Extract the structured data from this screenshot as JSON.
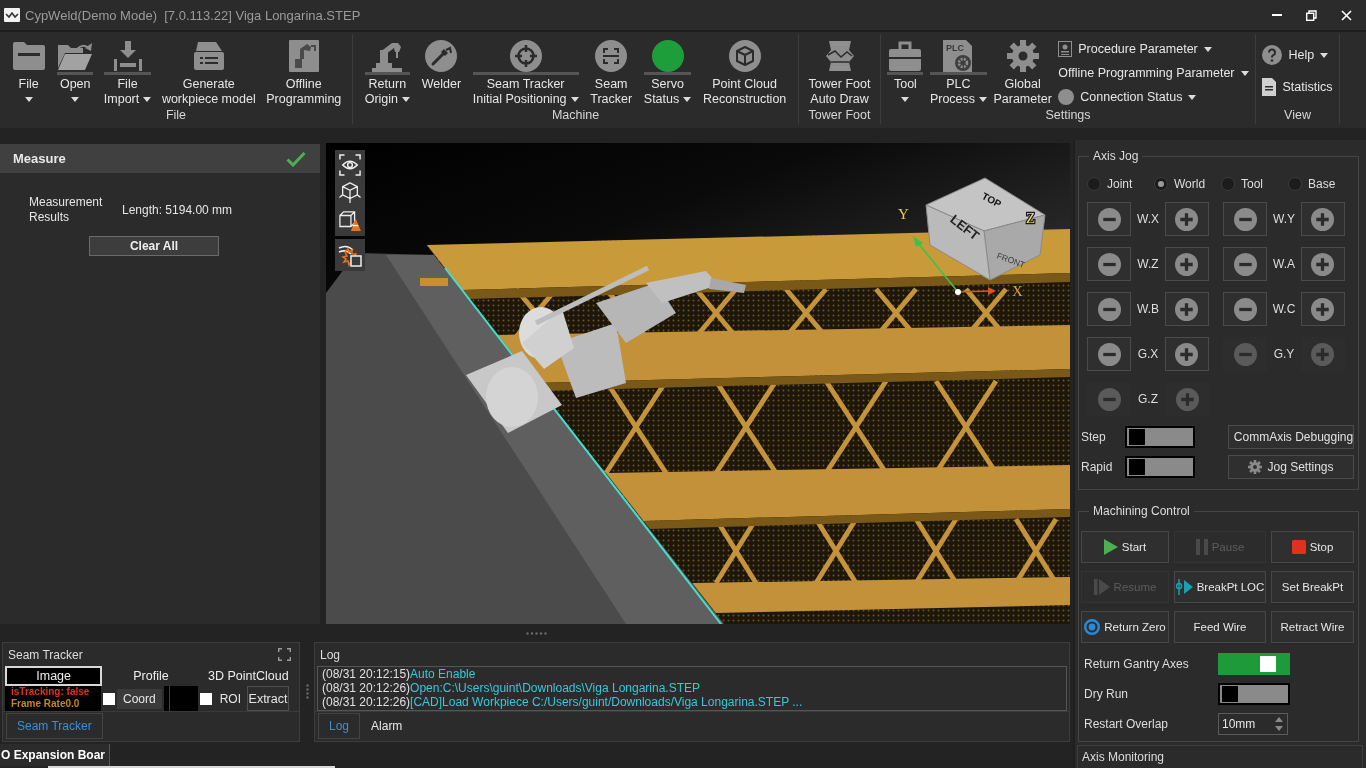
{
  "window": {
    "title": "CypWeld(Demo Mode)  [7.0.113.22] Viga Longarina.STEP"
  },
  "ribbon": {
    "groups": [
      {
        "label": "File",
        "items": [
          {
            "kind": "large",
            "lines": [
              "File"
            ],
            "dropdown": true
          },
          {
            "kind": "split",
            "lines": [
              "Open"
            ],
            "dropdown": true
          },
          {
            "kind": "split",
            "lines": [
              "File",
              "Import"
            ],
            "dropdown": true
          },
          {
            "kind": "large",
            "lines": [
              "Generate",
              "workpiece model"
            ],
            "dropdown": false
          },
          {
            "kind": "large",
            "lines": [
              "Offline",
              "Programming"
            ],
            "dropdown": false
          }
        ]
      },
      {
        "label": "Machine",
        "items": [
          {
            "kind": "split",
            "lines": [
              "Return",
              "Origin"
            ],
            "dropdown": true
          },
          {
            "kind": "large",
            "lines": [
              "Welder"
            ],
            "dropdown": false
          },
          {
            "kind": "split",
            "lines": [
              "Seam Tracker",
              "Initial Positioning"
            ],
            "dropdown": true
          },
          {
            "kind": "large",
            "lines": [
              "Seam",
              "Tracker"
            ],
            "dropdown": false
          },
          {
            "kind": "split",
            "lines": [
              "Servo",
              "Status"
            ],
            "dropdown": true,
            "on": true
          },
          {
            "kind": "large",
            "lines": [
              "Point Cloud",
              "Reconstruction"
            ],
            "dropdown": false
          }
        ]
      },
      {
        "label": "Tower Foot",
        "items": [
          {
            "kind": "large",
            "lines": [
              "Tower Foot",
              "Auto Draw"
            ],
            "dropdown": false
          }
        ]
      },
      {
        "label": "Settings",
        "items": [
          {
            "kind": "split",
            "lines": [
              "Tool"
            ],
            "dropdown": true
          },
          {
            "kind": "split",
            "lines": [
              "PLC",
              "Process"
            ],
            "dropdown": true,
            "icon_text": "PLC"
          },
          {
            "kind": "large",
            "lines": [
              "Global",
              "Parameter"
            ],
            "dropdown": false
          },
          {
            "kind": "small",
            "lines": [
              "Procedure Parameter"
            ],
            "dropdown": true
          },
          {
            "kind": "small",
            "lines": [
              "Offline Programming Parameter"
            ],
            "dropdown": true
          },
          {
            "kind": "small",
            "lines": [
              "Connection Status"
            ],
            "dropdown": true,
            "on": false
          }
        ]
      },
      {
        "label": "View",
        "items": [
          {
            "kind": "small",
            "lines": [
              "Help"
            ],
            "dropdown": true
          },
          {
            "kind": "small",
            "lines": [
              "Statistics"
            ],
            "dropdown": false
          }
        ]
      }
    ]
  },
  "measure": {
    "title": "Measure",
    "result_label": "Measurement Results",
    "result_value": "Length: 5194.00 mm",
    "clear_button": "Clear All"
  },
  "viewport": {
    "axis_labels": [
      "Y",
      "Z",
      "X"
    ],
    "view_cube_faces": [
      "LEFT",
      "FRONT",
      "TOP"
    ]
  },
  "seam_tracker": {
    "title": "Seam Tracker",
    "tabs": [
      {
        "label": "Image",
        "selected": true
      },
      {
        "label": "Profile",
        "selected": false
      },
      {
        "label": "3D PointCloud",
        "selected": false
      }
    ],
    "status_lines": [
      {
        "text": "isTracking: false",
        "color": "#e0301e"
      },
      {
        "text": "Frame Rate0.0",
        "color": "#c8861e"
      }
    ],
    "coord": {
      "label": "Coord",
      "checked": false
    },
    "roi": {
      "label": "ROI",
      "checked": false
    },
    "extract_button": "Extract",
    "bottom_tabs": [
      {
        "label": "Seam Tracker",
        "selected": true
      }
    ]
  },
  "log": {
    "title": "Log",
    "entries": [
      {
        "time": "(08/31 20:12:15)",
        "message": "Auto Enable"
      },
      {
        "time": "(08/31 20:12:26)",
        "message": "Open:C:\\Users\\guint\\Downloads\\Viga Longarina.STEP"
      },
      {
        "time": "(08/31 20:12:26)",
        "message": "[CAD]Load Workpiece C:/Users/guint/Downloads/Viga Longarina.STEP ..."
      }
    ],
    "tabs": [
      {
        "label": "Log",
        "selected": true
      },
      {
        "label": "Alarm",
        "selected": false
      }
    ]
  },
  "expansion_board": {
    "title": "O Expansion Boar"
  },
  "axis_jog": {
    "title": "Axis Jog",
    "modes": [
      {
        "label": "Joint",
        "selected": false
      },
      {
        "label": "World",
        "selected": true
      },
      {
        "label": "Tool",
        "selected": false
      },
      {
        "label": "Base",
        "selected": false
      }
    ],
    "axes": [
      {
        "label": "W.X",
        "disabled": false
      },
      {
        "label": "W.Y",
        "disabled": false
      },
      {
        "label": "W.Z",
        "disabled": false
      },
      {
        "label": "W.A",
        "disabled": false
      },
      {
        "label": "W.B",
        "disabled": false
      },
      {
        "label": "W.C",
        "disabled": false
      },
      {
        "label": "G.X",
        "disabled": false
      },
      {
        "label": "G.Y",
        "disabled": true
      },
      {
        "label": "G.Z",
        "disabled": true
      }
    ],
    "toggles": [
      {
        "label": "Step",
        "on": false,
        "button": "CommAxis Debugging"
      },
      {
        "label": "Rapid",
        "on": false,
        "button": "Jog Settings"
      }
    ]
  },
  "machining_control": {
    "title": "Machining Control",
    "buttons": [
      {
        "label": "Start",
        "disabled": false
      },
      {
        "label": "Pause",
        "disabled": true
      },
      {
        "label": "Stop",
        "disabled": false
      },
      {
        "label": "Resume",
        "disabled": true
      },
      {
        "label": "BreakPt LOC",
        "disabled": false
      },
      {
        "label": "Set BreakPt",
        "disabled": false
      },
      {
        "label": "Return Zero",
        "disabled": false
      },
      {
        "label": "Feed Wire",
        "disabled": false
      },
      {
        "label": "Retract Wire",
        "disabled": false
      }
    ],
    "switches": [
      {
        "label": "Return Gantry Axes",
        "on": true
      },
      {
        "label": "Dry Run",
        "on": false
      }
    ],
    "restart_overlap": {
      "label": "Restart Overlap",
      "value": "10mm"
    }
  },
  "axis_monitoring": {
    "title": "Axis Monitoring"
  }
}
